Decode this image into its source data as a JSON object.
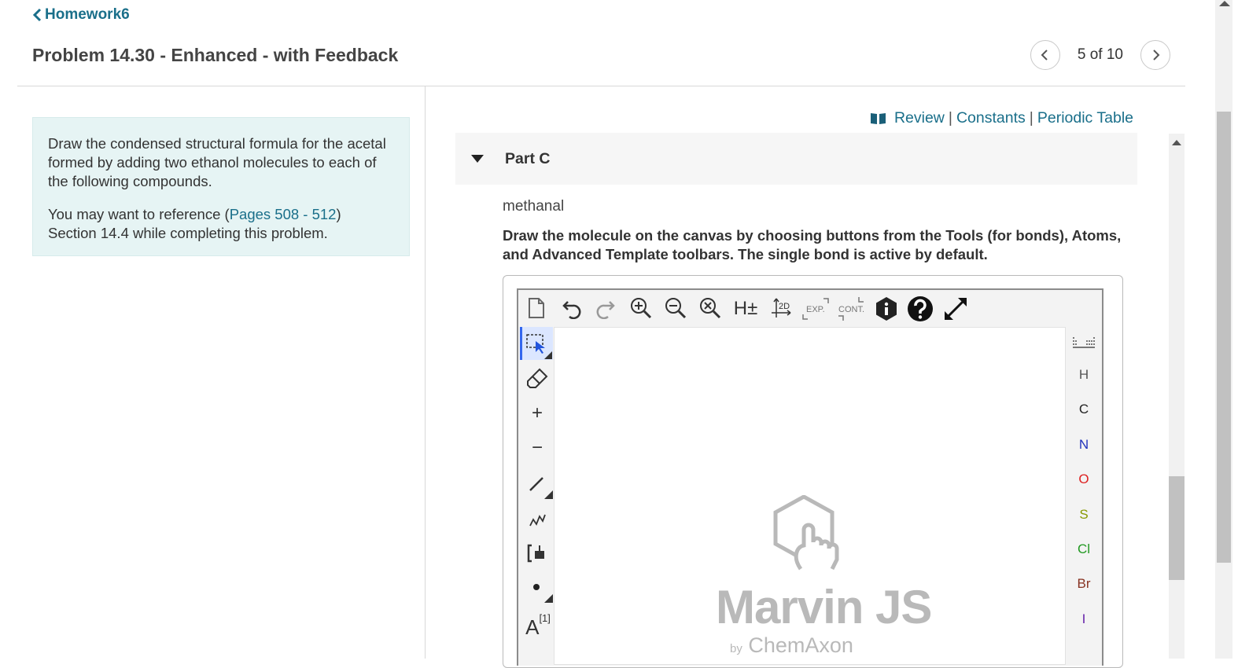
{
  "header": {
    "back_label": "Homework6",
    "title": "Problem 14.30 - Enhanced - with Feedback",
    "pager_text": "5 of 10"
  },
  "info": {
    "paragraph1": "Draw the condensed structural formula for the acetal formed by adding two ethanol molecules to each of the following compounds.",
    "ref_prefix": "You may want to reference (",
    "ref_link": "Pages 508 - 512",
    "ref_suffix": ")",
    "ref_line2": "Section 14.4 while completing this problem."
  },
  "top_links": {
    "review": "Review",
    "constants": "Constants",
    "periodic_table": "Periodic Table",
    "separator": "|"
  },
  "part": {
    "label": "Part C",
    "compound": "methanal",
    "instructions": "Draw the molecule on the canvas by choosing buttons from the Tools (for bonds), Atoms, and Advanced Template toolbars. The single bond is active by default."
  },
  "editor": {
    "toolbar": {
      "h_label": "H±",
      "twod_label": "2D",
      "exp_label": "EXP.",
      "cont_label": "CONT."
    },
    "left_tools": {
      "plus": "+",
      "minus": "−",
      "text_tool": "A",
      "text_tool_sup": "[1]"
    },
    "atoms": [
      {
        "symbol": "H",
        "color": "#555555"
      },
      {
        "symbol": "C",
        "color": "#222222"
      },
      {
        "symbol": "N",
        "color": "#2233bb"
      },
      {
        "symbol": "O",
        "color": "#dd2222"
      },
      {
        "symbol": "S",
        "color": "#889900"
      },
      {
        "symbol": "Cl",
        "color": "#229922"
      },
      {
        "symbol": "Br",
        "color": "#883322"
      },
      {
        "symbol": "I",
        "color": "#6622aa"
      }
    ],
    "brand": "Marvin JS",
    "brand_by": "by",
    "brand_company": "ChemAxon"
  },
  "colors": {
    "link": "#1a6f8a",
    "info_bg": "#e6f4f4"
  }
}
